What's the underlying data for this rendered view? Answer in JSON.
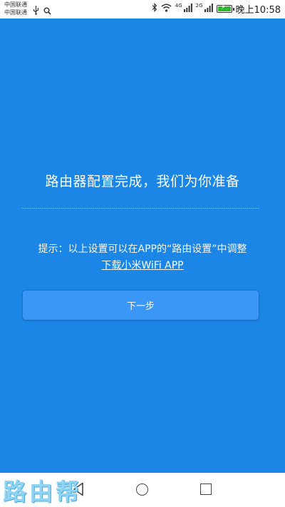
{
  "status_bar": {
    "carrier_1": "中国联通",
    "carrier_2": "中国联通",
    "net_4g": "4G",
    "net_2g": "2G",
    "time": "晚上10:58",
    "battery_level": 1.0,
    "battery_color": "#2eb82e"
  },
  "main": {
    "background_color": "#1c86e6",
    "title": "路由器配置完成，我们为你准备",
    "hint": "提示：以上设置可以在APP的“路由设置”中调整",
    "download_link": "下载小米WiFi APP",
    "next_button": "下一步"
  },
  "nav_bar": {
    "icons": [
      "back-icon",
      "home-icon",
      "recent-apps-icon"
    ]
  },
  "watermark": "路由帮"
}
